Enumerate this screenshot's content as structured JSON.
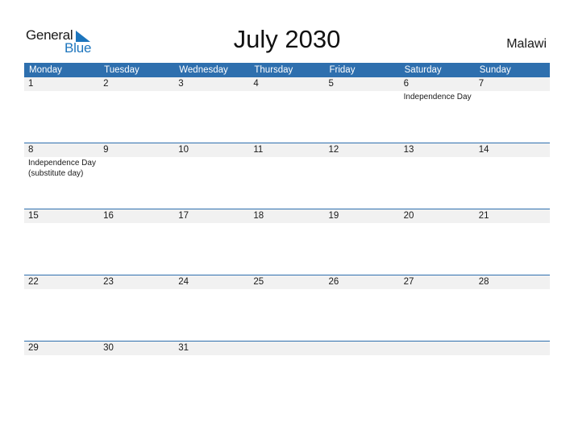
{
  "logo": {
    "word1": "General",
    "word2": "Blue"
  },
  "title": "July 2030",
  "country": "Malawi",
  "weekdays": [
    "Monday",
    "Tuesday",
    "Wednesday",
    "Thursday",
    "Friday",
    "Saturday",
    "Sunday"
  ],
  "weeks": [
    {
      "days": [
        "1",
        "2",
        "3",
        "4",
        "5",
        "6",
        "7"
      ],
      "events": [
        "",
        "",
        "",
        "",
        "",
        "Independence Day",
        ""
      ]
    },
    {
      "days": [
        "8",
        "9",
        "10",
        "11",
        "12",
        "13",
        "14"
      ],
      "events": [
        "Independence Day (substitute day)",
        "",
        "",
        "",
        "",
        "",
        ""
      ]
    },
    {
      "days": [
        "15",
        "16",
        "17",
        "18",
        "19",
        "20",
        "21"
      ],
      "events": [
        "",
        "",
        "",
        "",
        "",
        "",
        ""
      ]
    },
    {
      "days": [
        "22",
        "23",
        "24",
        "25",
        "26",
        "27",
        "28"
      ],
      "events": [
        "",
        "",
        "",
        "",
        "",
        "",
        ""
      ]
    },
    {
      "days": [
        "29",
        "30",
        "31",
        "",
        "",
        "",
        ""
      ],
      "events": [
        "",
        "",
        "",
        "",
        "",
        "",
        ""
      ]
    }
  ],
  "colors": {
    "accent": "#2e6fae",
    "logo_blue": "#1d75bd",
    "date_row_bg": "#f1f1f1"
  }
}
